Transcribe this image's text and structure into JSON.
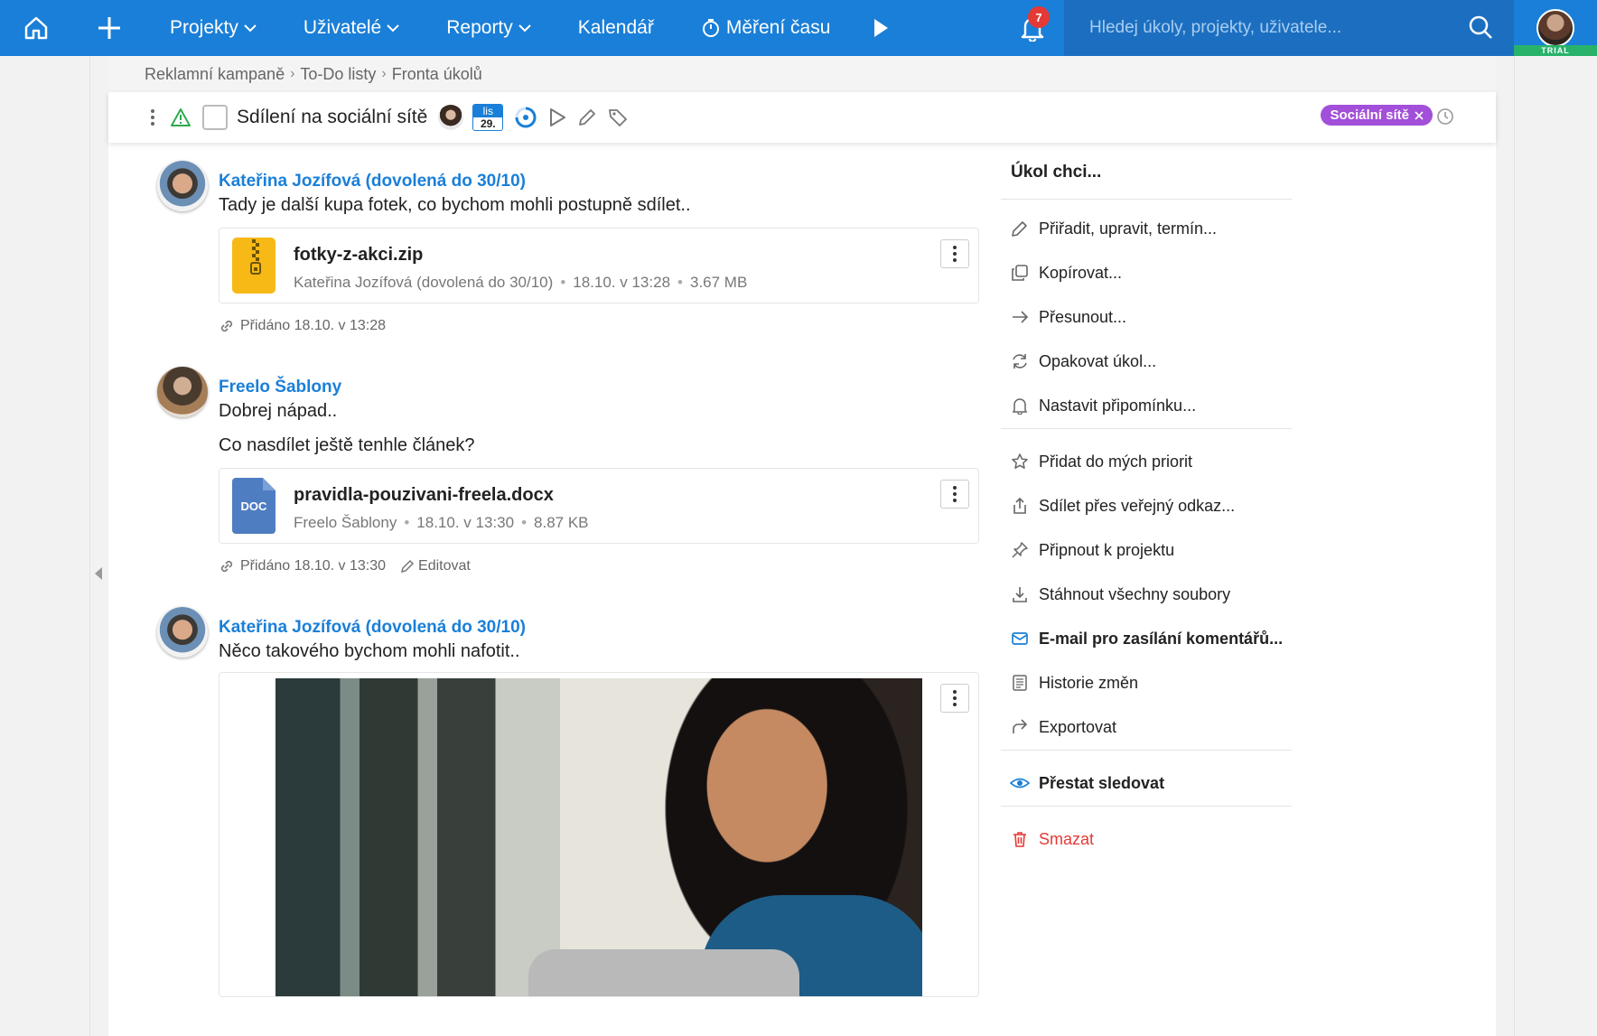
{
  "nav": {
    "items": [
      {
        "label": "Projekty",
        "dropdown": true
      },
      {
        "label": "Uživatelé",
        "dropdown": true
      },
      {
        "label": "Reporty",
        "dropdown": true
      },
      {
        "label": "Kalendář",
        "dropdown": false
      },
      {
        "label": "Měření času",
        "dropdown": false
      }
    ],
    "notifications_count": "7",
    "search_placeholder": "Hledej úkoly, projekty, uživatele...",
    "trial_label": "TRIAL",
    "colors": {
      "bar": "#1a7fd8",
      "search_bg": "#1c6fc0",
      "trial": "#28b26a",
      "badge": "#e53935"
    }
  },
  "breadcrumb": [
    "Reklamní kampaně",
    "To-Do listy",
    "Fronta úkolů"
  ],
  "task": {
    "title": "Sdílení na sociální sítě",
    "date_month": "lis",
    "date_day": "29.",
    "tag": "Sociální sítě",
    "tag_color": "#a24fd9"
  },
  "comments": [
    {
      "author": "Kateřina Jozífová (dovolená do 30/10)",
      "text": "Tady je další kupa fotek, co bychom mohli postupně sdílet..",
      "file": {
        "name": "fotky-z-akci.zip",
        "author": "Kateřina Jozífová (dovolená do 30/10)",
        "date": "18.10. v 13:28",
        "size": "3.67 MB",
        "type": "zip"
      },
      "added": "Přidáno 18.10. v 13:28"
    },
    {
      "author": "Freelo Šablony",
      "text": "Dobrej nápad..",
      "text2": "Co nasdílet ještě tenhle článek?",
      "file": {
        "name": "pravidla-pouzivani-freela.docx",
        "author": "Freelo Šablony",
        "date": "18.10. v 13:30",
        "size": "8.87 KB",
        "type": "doc",
        "type_label": "DOC"
      },
      "added": "Přidáno 18.10. v 13:30",
      "edit": "Editovat"
    },
    {
      "author": "Kateřina Jozífová (dovolená do 30/10)",
      "text": "Něco takového bychom mohli nafotit.."
    }
  ],
  "panel": {
    "title": "Úkol chci...",
    "group1": [
      {
        "label": "Přiřadit, upravit, termín...",
        "icon": "pencil-icon"
      },
      {
        "label": "Kopírovat...",
        "icon": "copy-icon"
      },
      {
        "label": "Přesunout...",
        "icon": "arrow-right-icon"
      },
      {
        "label": "Opakovat úkol...",
        "icon": "repeat-icon"
      },
      {
        "label": "Nastavit připomínku...",
        "icon": "bell-plus-icon"
      }
    ],
    "group2": [
      {
        "label": "Přidat do mých priorit",
        "icon": "star-icon"
      },
      {
        "label": "Sdílet přes veřejný odkaz...",
        "icon": "share-icon"
      },
      {
        "label": "Připnout k projektu",
        "icon": "pin-icon"
      },
      {
        "label": "Stáhnout všechny soubory",
        "icon": "download-icon"
      },
      {
        "label": "E-mail pro zasílání komentářů...",
        "icon": "email-icon"
      },
      {
        "label": "Historie změn",
        "icon": "history-icon"
      },
      {
        "label": "Exportovat",
        "icon": "export-icon"
      }
    ],
    "unfollow": "Přestat sledovat",
    "delete": "Smazat"
  }
}
